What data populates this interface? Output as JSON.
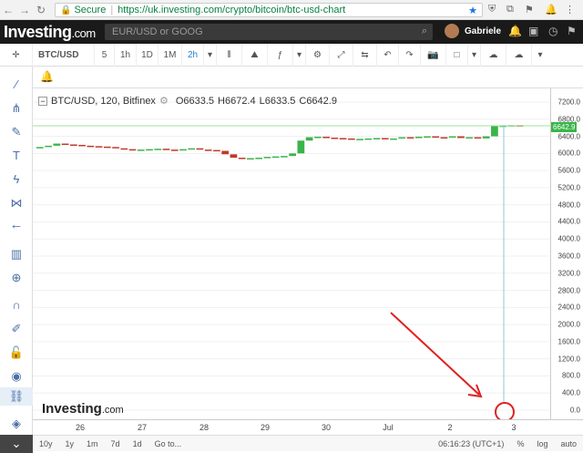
{
  "browser": {
    "secure_label": "Secure",
    "url": "https://uk.investing.com/crypto/bitcoin/btc-usd-chart"
  },
  "site": {
    "logo_main": "Investing",
    "logo_suffix": ".com",
    "search_placeholder": "EUR/USD or GOOG",
    "user_name": "Gabriele"
  },
  "toolbar": {
    "symbol": "BTC/USD",
    "intervals": [
      "5",
      "1h",
      "1D",
      "1M",
      "2h"
    ],
    "active_interval": "2h"
  },
  "legend": {
    "title": "BTC/USD, 120, Bitfinex",
    "open": "O6633.5",
    "high": "H6672.4",
    "low": "L6633.5",
    "close": "C6642.9"
  },
  "chart_data": {
    "type": "candlestick",
    "x": [
      "26",
      "27",
      "28",
      "29",
      "30",
      "Jul",
      "2",
      "3"
    ],
    "y_ticks": [
      "7200.0",
      "6800.0",
      "6400.0",
      "6000.0",
      "5600.0",
      "5200.0",
      "4800.0",
      "4400.0",
      "4000.0",
      "3600.0",
      "3200.0",
      "2800.0",
      "2400.0",
      "2000.0",
      "1600.0",
      "1200.0",
      "800.0",
      "400.0",
      "0.0"
    ],
    "ylim": [
      0,
      7200
    ],
    "last_price": "6642.9",
    "close_series": [
      6150,
      6180,
      6230,
      6210,
      6200,
      6180,
      6170,
      6160,
      6150,
      6120,
      6100,
      6080,
      6090,
      6100,
      6110,
      6090,
      6080,
      6100,
      6120,
      6090,
      6080,
      6060,
      5980,
      5900,
      5880,
      5890,
      5900,
      5920,
      5930,
      5940,
      6000,
      6300,
      6380,
      6390,
      6370,
      6360,
      6350,
      6330,
      6340,
      6350,
      6360,
      6340,
      6350,
      6380,
      6370,
      6390,
      6400,
      6380,
      6370,
      6400,
      6360,
      6380,
      6350,
      6400,
      6640,
      6650,
      6660,
      6642.9
    ]
  },
  "watermark": {
    "main": "Investing",
    "suffix": ".com"
  },
  "bottom": {
    "ranges": [
      "10y",
      "1y",
      "1m",
      "7d",
      "1d",
      "Go to..."
    ],
    "time": "06:16:23 (UTC+1)",
    "pct": "%",
    "log": "log",
    "auto": "auto"
  }
}
